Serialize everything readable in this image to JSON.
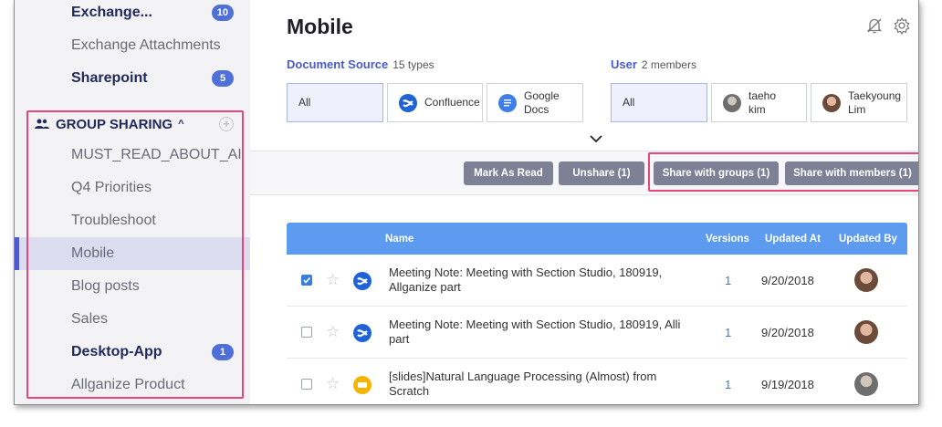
{
  "sidebar": {
    "items_top": [
      {
        "label": "Exchange...",
        "badge": "10",
        "bold": true
      },
      {
        "label": "Exchange Attachments",
        "badge": "",
        "bold": false
      },
      {
        "label": "Sharepoint",
        "badge": "5",
        "bold": true
      }
    ],
    "group": {
      "label": "GROUP SHARING",
      "caret": "^",
      "plus": "+"
    },
    "group_items": [
      {
        "label": "MUST_READ_ABOUT_AI",
        "badge": "",
        "bold": false
      },
      {
        "label": "Q4 Priorities",
        "badge": "",
        "bold": false
      },
      {
        "label": "Troubleshoot",
        "badge": "",
        "bold": false
      },
      {
        "label": "Mobile",
        "badge": "",
        "bold": false,
        "active": true
      },
      {
        "label": "Blog posts",
        "badge": "",
        "bold": false
      },
      {
        "label": "Sales",
        "badge": "",
        "bold": false
      },
      {
        "label": "Desktop-App",
        "badge": "1",
        "bold": true
      },
      {
        "label": "Allganize Product",
        "badge": "",
        "bold": false
      }
    ]
  },
  "main": {
    "title": "Mobile",
    "doc_source": {
      "label": "Document Source",
      "count": "15 types",
      "chips": [
        {
          "label": "All",
          "selected": true,
          "icon": ""
        },
        {
          "label": "Confluence",
          "selected": false,
          "icon": "confluence-icon"
        },
        {
          "label": "Google Docs",
          "selected": false,
          "icon": "google-docs-icon"
        }
      ]
    },
    "user": {
      "label": "User",
      "count": "2 members",
      "chips": [
        {
          "label": "All",
          "selected": true
        },
        {
          "label": "taeho kim",
          "selected": false
        },
        {
          "label": "Taekyoung Lim",
          "selected": false
        }
      ]
    },
    "actions": {
      "mark_read": "Mark As Read",
      "unshare": "Unshare (1)",
      "share_groups": "Share with groups (1)",
      "share_members": "Share with members (1)"
    },
    "table": {
      "columns": {
        "name": "Name",
        "versions": "Versions",
        "updated_at": "Updated At",
        "updated_by": "Updated By"
      },
      "rows": [
        {
          "checked": true,
          "icon": "confluence-icon",
          "name": "Meeting Note: Meeting with Section Studio, 180919, Allganize part",
          "versions": "1",
          "date": "9/20/2018"
        },
        {
          "checked": false,
          "icon": "confluence-icon",
          "name": "Meeting Note: Meeting with Section Studio, 180919, Alli part",
          "versions": "1",
          "date": "9/20/2018"
        },
        {
          "checked": false,
          "icon": "google-slides-icon",
          "name": "[slides]Natural Language Processing (Almost) from Scratch",
          "versions": "1",
          "date": "9/19/2018"
        }
      ]
    }
  },
  "colors": {
    "accent": "#4f5bd5",
    "badge": "#4f6fd9",
    "table_header": "#5d9bf0",
    "highlight": "#e8467c",
    "action_button": "#7e8196"
  }
}
